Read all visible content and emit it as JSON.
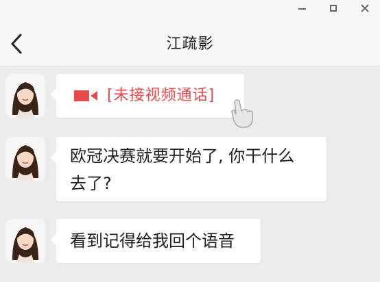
{
  "window": {
    "controls": [
      "minimize",
      "maximize",
      "close"
    ]
  },
  "header": {
    "title": "江疏影",
    "back_icon": "chevron-left-icon"
  },
  "messages": [
    {
      "type": "video-call",
      "text": "[未接视频通话]",
      "icon": "video-camera-icon",
      "color": "#e64a4a"
    },
    {
      "type": "text",
      "line1": "欧冠决赛就要开始了, 你干什么",
      "line2": "去了?"
    },
    {
      "type": "text",
      "text": "看到记得给我回个语音"
    }
  ],
  "colors": {
    "background": "#ececec",
    "bubble": "#ffffff",
    "missed_call": "#e64a4a"
  }
}
